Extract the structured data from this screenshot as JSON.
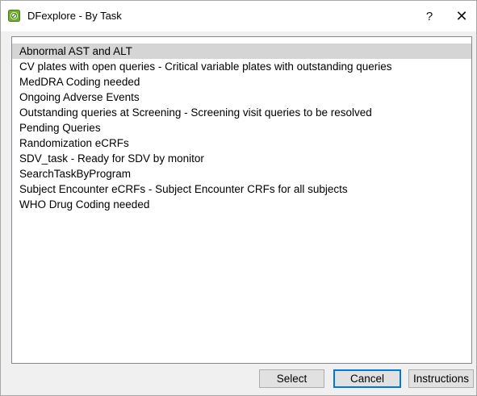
{
  "window": {
    "title": "DFexplore - By Task",
    "help_glyph": "?",
    "close_glyph": "✕",
    "icon": "dfexplore-app-icon"
  },
  "task_list": {
    "selected_index": 0,
    "items": [
      "Abnormal AST and ALT",
      "CV plates with open queries - Critical variable plates with outstanding queries",
      "MedDRA Coding needed",
      "Ongoing Adverse Events",
      "Outstanding queries at Screening - Screening visit queries to be resolved",
      "Pending Queries",
      "Randomization eCRFs",
      "SDV_task - Ready for SDV by monitor",
      "SearchTaskByProgram",
      "Subject Encounter eCRFs - Subject Encounter CRFs for all subjects",
      "WHO Drug Coding needed"
    ]
  },
  "buttons": {
    "select": "Select",
    "cancel": "Cancel",
    "instructions": "Instructions"
  },
  "colors": {
    "selection": "#d5d5d5",
    "focus_border": "#0078d7",
    "app_icon_green": "#5a9a1c"
  }
}
